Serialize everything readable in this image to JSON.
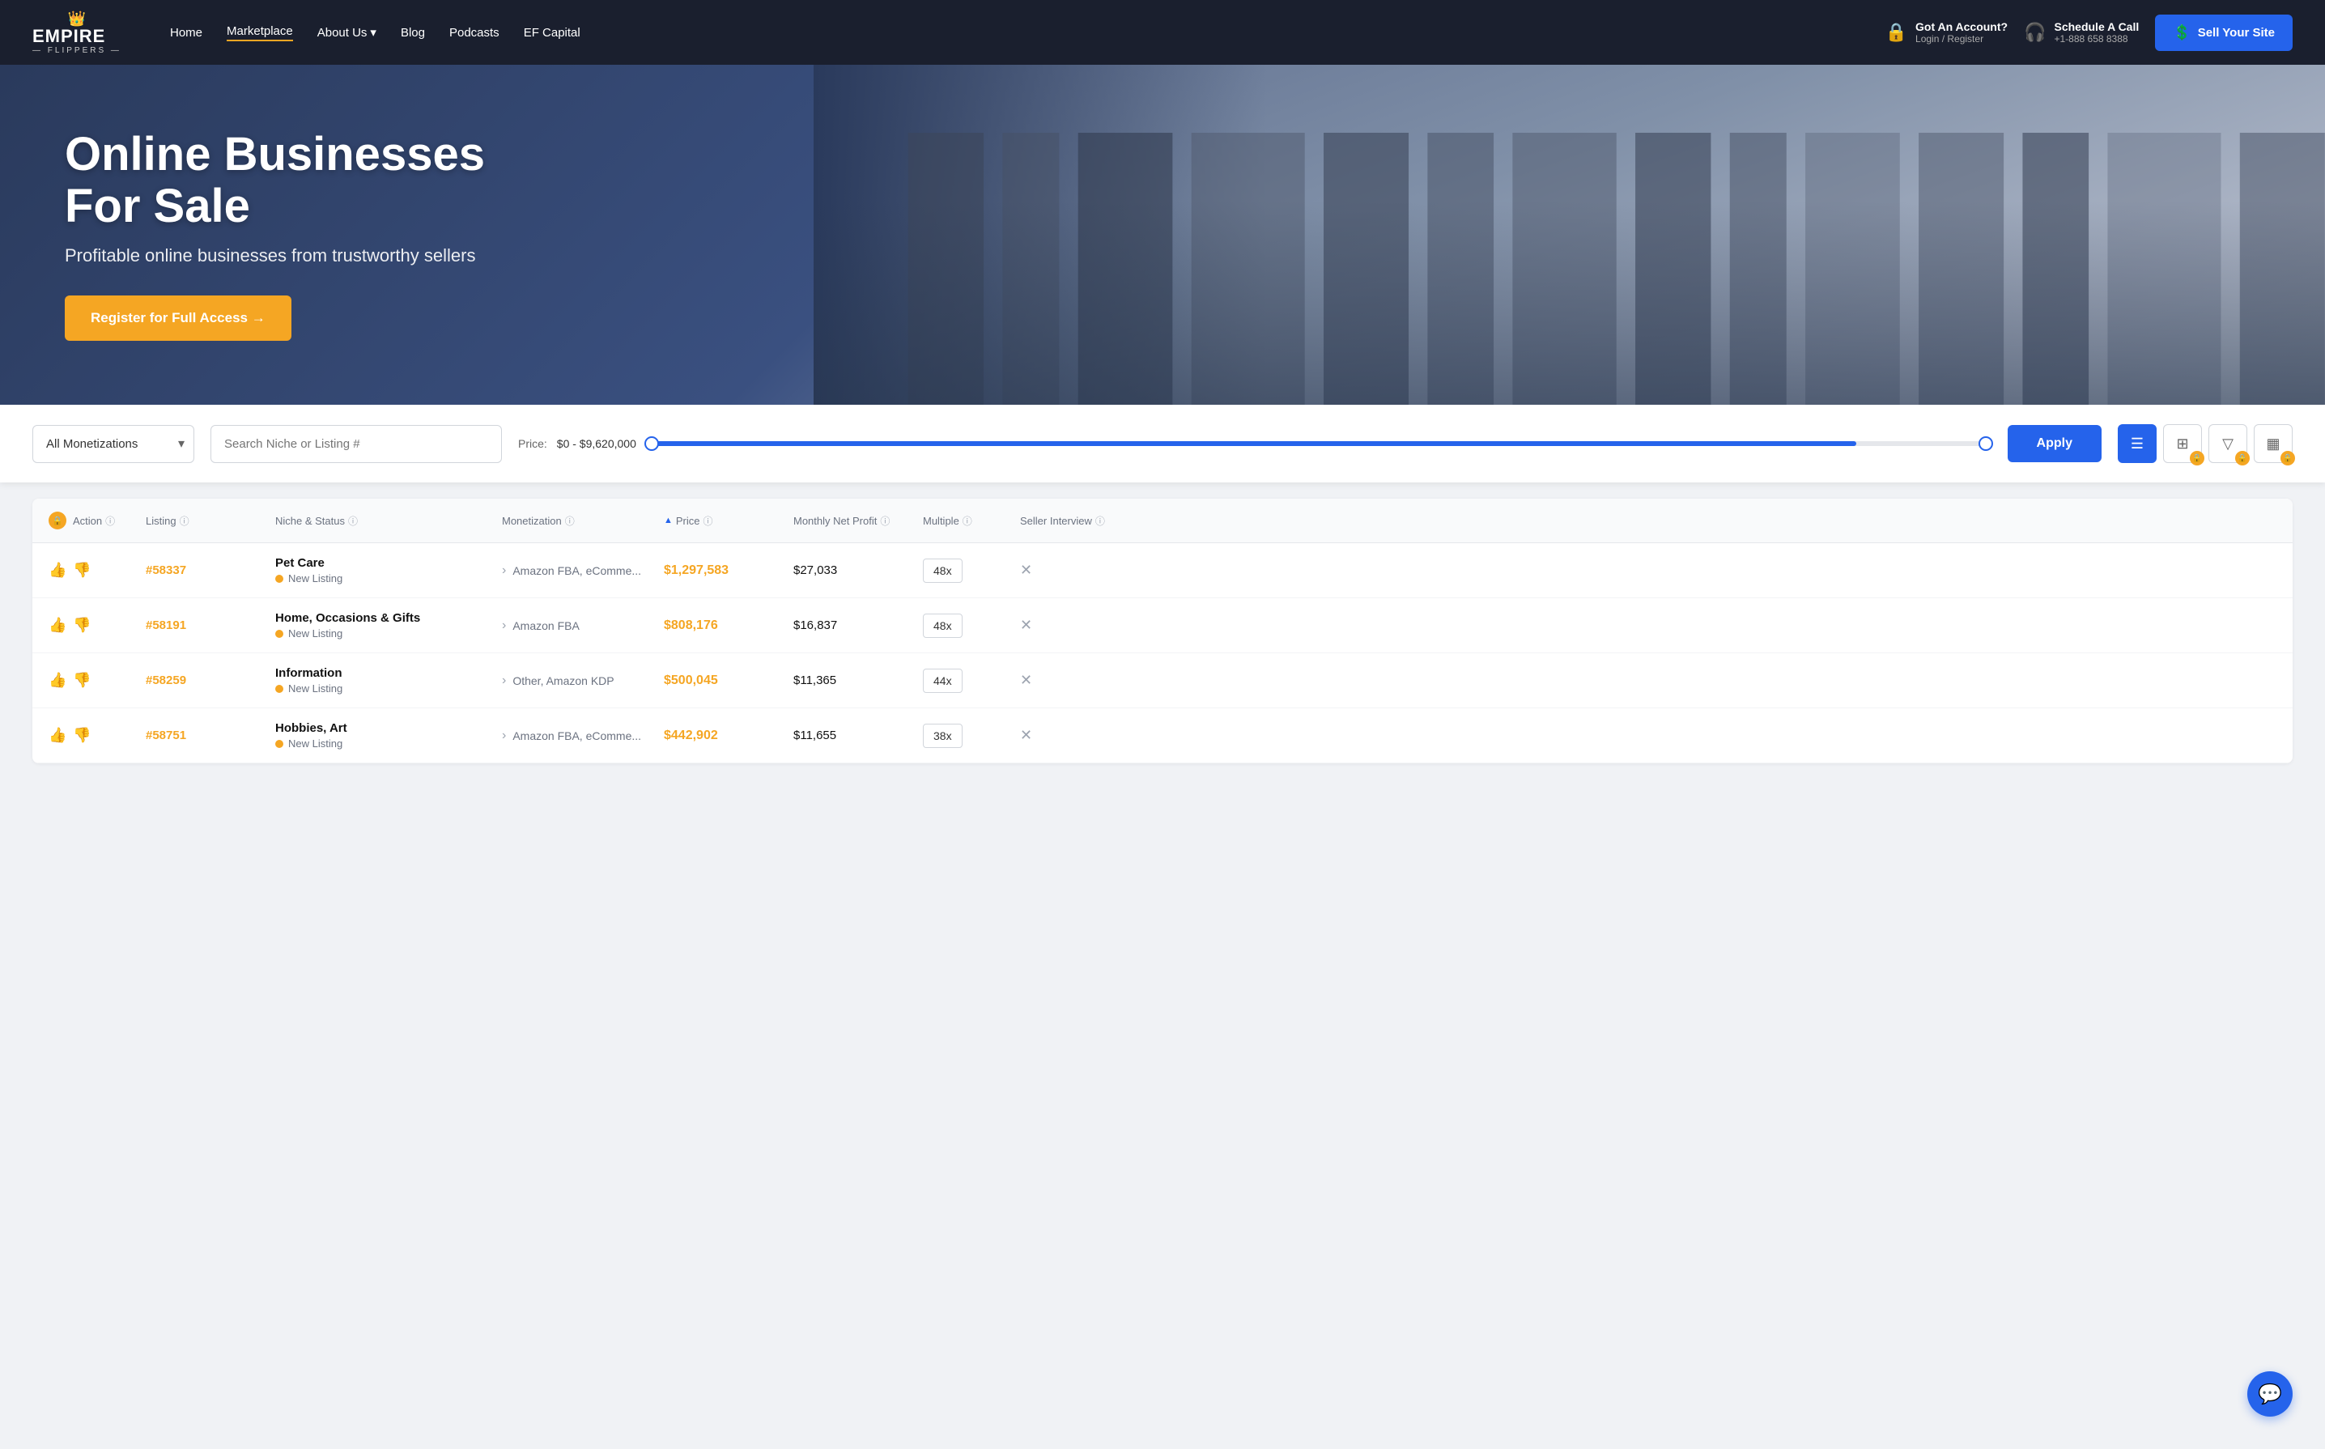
{
  "navbar": {
    "logo": {
      "crown": "👑",
      "name": "EMPIRE",
      "sub": "— FLIPPERS —"
    },
    "links": [
      {
        "id": "home",
        "label": "Home",
        "active": false
      },
      {
        "id": "marketplace",
        "label": "Marketplace",
        "active": true
      },
      {
        "id": "about",
        "label": "About Us",
        "active": false,
        "dropdown": true
      },
      {
        "id": "blog",
        "label": "Blog",
        "active": false
      },
      {
        "id": "podcasts",
        "label": "Podcasts",
        "active": false
      },
      {
        "id": "ef-capital",
        "label": "EF Capital",
        "active": false
      }
    ],
    "account": {
      "icon": "🔒",
      "title": "Got An Account?",
      "subtitle": "Login / Register"
    },
    "schedule": {
      "icon": "🎧",
      "title": "Schedule A Call",
      "subtitle": "+1-888 658 8388"
    },
    "sell_btn": {
      "icon": "$",
      "label": "Sell Your Site"
    }
  },
  "hero": {
    "title": "Online Businesses For Sale",
    "subtitle": "Profitable online businesses from trustworthy sellers",
    "register_btn": "Register for Full Access →"
  },
  "search": {
    "monetization_placeholder": "All Monetizations",
    "search_placeholder": "Search Niche or Listing #",
    "price_label": "Price:",
    "price_range": "$0 - $9,620,000",
    "apply_btn": "Apply",
    "view_icons": [
      {
        "id": "list-view",
        "icon": "☰",
        "active": true,
        "locked": false
      },
      {
        "id": "grid-view",
        "icon": "⊞",
        "active": false,
        "locked": true
      },
      {
        "id": "filter-view",
        "icon": "▽",
        "active": false,
        "locked": true
      },
      {
        "id": "bar-view",
        "icon": "▦",
        "active": false,
        "locked": true
      }
    ]
  },
  "table": {
    "headers": [
      {
        "id": "action",
        "label": "Action",
        "locked": true,
        "info": true
      },
      {
        "id": "listing",
        "label": "Listing",
        "info": true
      },
      {
        "id": "niche",
        "label": "Niche & Status",
        "info": true
      },
      {
        "id": "monetization",
        "label": "Monetization",
        "info": true
      },
      {
        "id": "price",
        "label": "Price",
        "sort": "asc",
        "info": true
      },
      {
        "id": "monthly-profit",
        "label": "Monthly Net Profit",
        "info": true
      },
      {
        "id": "multiple",
        "label": "Multiple",
        "info": true
      },
      {
        "id": "interview",
        "label": "Seller Interview",
        "info": true
      }
    ],
    "rows": [
      {
        "listing_id": "#58337",
        "niche": "Pet Care",
        "status": "New Listing",
        "monetization": "Amazon FBA, eComme...",
        "price": "$1,297,583",
        "monthly_profit": "$27,033",
        "multiple": "48x",
        "has_interview": false
      },
      {
        "listing_id": "#58191",
        "niche": "Home, Occasions & Gifts",
        "status": "New Listing",
        "monetization": "Amazon FBA",
        "price": "$808,176",
        "monthly_profit": "$16,837",
        "multiple": "48x",
        "has_interview": false
      },
      {
        "listing_id": "#58259",
        "niche": "Information",
        "status": "New Listing",
        "monetization": "Other, Amazon KDP",
        "price": "$500,045",
        "monthly_profit": "$11,365",
        "multiple": "44x",
        "has_interview": false
      },
      {
        "listing_id": "#58751",
        "niche": "Hobbies, Art",
        "status": "New Listing",
        "monetization": "Amazon FBA, eComme...",
        "price": "$442,902",
        "monthly_profit": "$11,655",
        "multiple": "38x",
        "has_interview": false
      }
    ]
  }
}
